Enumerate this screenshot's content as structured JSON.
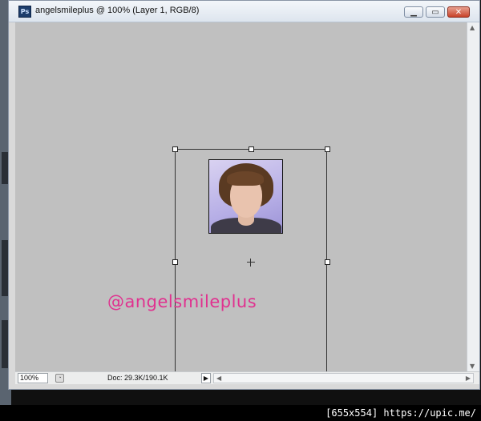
{
  "window": {
    "app_icon_text": "Ps",
    "title": "angelsmileplus @ 100% (Layer 1, RGB/8)",
    "buttons": {
      "minimize": "▁",
      "maximize": "▭",
      "close": "✕"
    }
  },
  "canvas": {
    "background_color": "#c0c0c0",
    "watermark": "@angelsmileplus",
    "watermark_color": "#e0318f",
    "layer_image": "portrait-photo"
  },
  "statusbar": {
    "zoom": "100%",
    "doc_info": "Doc: 29.3K/190.1K",
    "arrow": "▶",
    "scroll_left": "◀",
    "scroll_right": "▶"
  },
  "scrollbar": {
    "up": "▲",
    "down": "▼"
  },
  "footer": {
    "text": "[655x554] https://upic.me/"
  }
}
